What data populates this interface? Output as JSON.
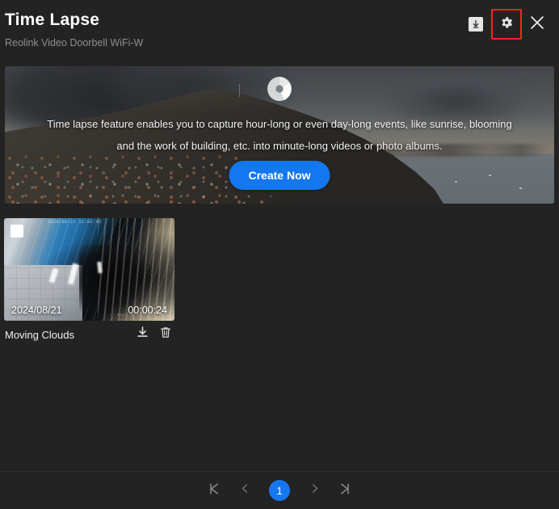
{
  "header": {
    "title": "Time Lapse",
    "subtitle": "Reolink Video Doorbell WiFi-W",
    "actions": {
      "download_icon": "download-icon",
      "settings_icon": "gear-icon",
      "close_icon": "close-icon"
    },
    "highlight_color": "#fc2121"
  },
  "banner": {
    "logo_icon": "aperture-logo-icon",
    "description": "Time lapse feature enables you to capture hour-long or even day-long events, like sunrise, blooming and the work of building, etc. into minute-long videos or photo albums.",
    "cta_label": "Create Now",
    "cta_color": "#1477f0"
  },
  "gallery": {
    "items": [
      {
        "title": "Moving Clouds",
        "date": "2024/08/21",
        "duration": "00:00:24",
        "osd_timestamp": "2024/08/21 11:02:43",
        "osd_camera": "Reolink Doorbell WiFi",
        "selected": true,
        "download_icon": "download-icon",
        "delete_icon": "trash-icon"
      }
    ]
  },
  "pagination": {
    "first_label": "first-page-icon",
    "prev_label": "prev-page-icon",
    "current_page": "1",
    "next_label": "next-page-icon",
    "last_label": "last-page-icon",
    "active_color": "#1677f0"
  }
}
